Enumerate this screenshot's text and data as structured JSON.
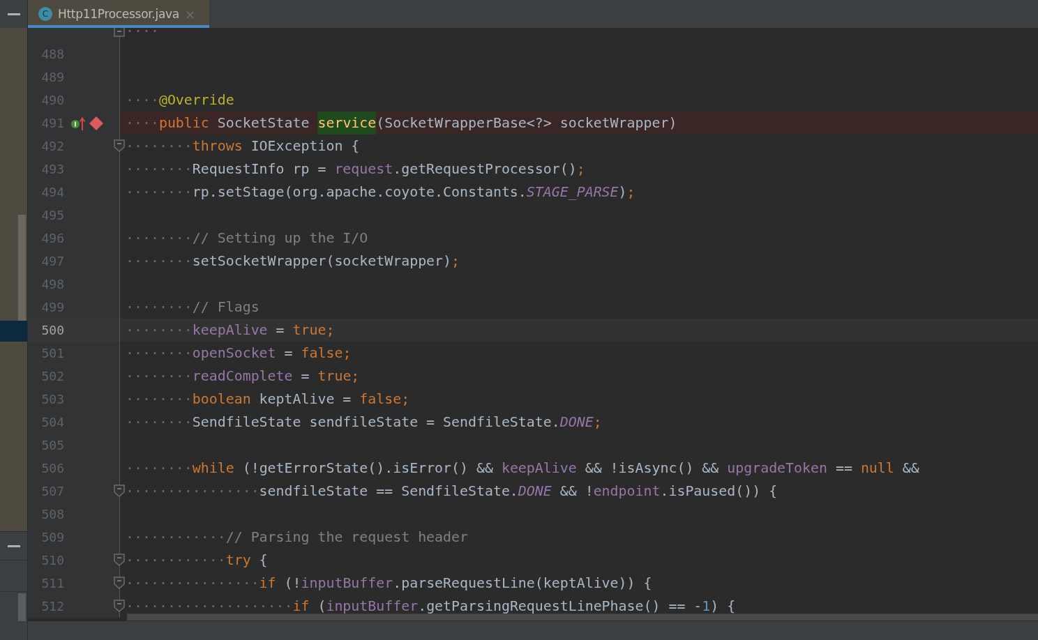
{
  "tab": {
    "icon_letter": "C",
    "label": "Http11Processor.java",
    "close": "×",
    "selected": true
  },
  "lines": [
    {
      "fold_close": true,
      "tokens": [
        {
          "kind": "ws",
          "text": "····"
        }
      ]
    },
    {
      "number": "488"
    },
    {
      "number": "489"
    },
    {
      "number": "490",
      "tokens": [
        {
          "kind": "ws",
          "text": "····"
        },
        {
          "kind": "annotation",
          "text": "@Override"
        }
      ]
    },
    {
      "number": "491",
      "breakpoint": true,
      "override_marker": true,
      "tokens": [
        {
          "kind": "ws",
          "text": "····"
        },
        {
          "kind": "keyword",
          "text": "public"
        },
        {
          "kind": "plain",
          "text": " SocketState "
        },
        {
          "kind": "declaration",
          "text": "service"
        },
        {
          "kind": "plain",
          "text": "(SocketWrapperBase<?> socketWrapper)"
        }
      ]
    },
    {
      "number": "492",
      "fold_open": true,
      "tokens": [
        {
          "kind": "ws",
          "text": "········"
        },
        {
          "kind": "keyword",
          "text": "throws"
        },
        {
          "kind": "plain",
          "text": " IOException {"
        }
      ]
    },
    {
      "number": "493",
      "tokens": [
        {
          "kind": "ws",
          "text": "········"
        },
        {
          "kind": "plain",
          "text": "RequestInfo rp = "
        },
        {
          "kind": "field",
          "text": "request"
        },
        {
          "kind": "plain",
          "text": ".getRequestProcessor()"
        },
        {
          "kind": "keyword",
          "text": ";"
        }
      ]
    },
    {
      "number": "494",
      "tokens": [
        {
          "kind": "ws",
          "text": "········"
        },
        {
          "kind": "plain",
          "text": "rp.setStage(org.apache.coyote.Constants."
        },
        {
          "kind": "constant",
          "text": "STAGE_PARSE"
        },
        {
          "kind": "plain",
          "text": ")"
        },
        {
          "kind": "keyword",
          "text": ";"
        }
      ]
    },
    {
      "number": "495"
    },
    {
      "number": "496",
      "tokens": [
        {
          "kind": "ws",
          "text": "········"
        },
        {
          "kind": "comment",
          "text": "// Setting up the I/O"
        }
      ]
    },
    {
      "number": "497",
      "tokens": [
        {
          "kind": "ws",
          "text": "········"
        },
        {
          "kind": "plain",
          "text": "setSocketWrapper(socketWrapper)"
        },
        {
          "kind": "keyword",
          "text": ";"
        }
      ]
    },
    {
      "number": "498"
    },
    {
      "number": "499",
      "tokens": [
        {
          "kind": "ws",
          "text": "········"
        },
        {
          "kind": "comment",
          "text": "// Flags"
        }
      ]
    },
    {
      "number": "500",
      "current": true,
      "tokens": [
        {
          "kind": "ws",
          "text": "········"
        },
        {
          "kind": "field",
          "text": "keepAlive"
        },
        {
          "kind": "plain",
          "text": " = "
        },
        {
          "kind": "keyword",
          "text": "true;"
        }
      ]
    },
    {
      "number": "501",
      "tokens": [
        {
          "kind": "ws",
          "text": "········"
        },
        {
          "kind": "field",
          "text": "openSocket"
        },
        {
          "kind": "plain",
          "text": " = "
        },
        {
          "kind": "keyword",
          "text": "false;"
        }
      ]
    },
    {
      "number": "502",
      "tokens": [
        {
          "kind": "ws",
          "text": "········"
        },
        {
          "kind": "field",
          "text": "readComplete"
        },
        {
          "kind": "plain",
          "text": " = "
        },
        {
          "kind": "keyword",
          "text": "true;"
        }
      ]
    },
    {
      "number": "503",
      "tokens": [
        {
          "kind": "ws",
          "text": "········"
        },
        {
          "kind": "keyword",
          "text": "boolean"
        },
        {
          "kind": "plain",
          "text": " keptAlive = "
        },
        {
          "kind": "keyword",
          "text": "false;"
        }
      ]
    },
    {
      "number": "504",
      "tokens": [
        {
          "kind": "ws",
          "text": "········"
        },
        {
          "kind": "plain",
          "text": "SendfileState sendfileState = SendfileState."
        },
        {
          "kind": "constant",
          "text": "DONE"
        },
        {
          "kind": "keyword",
          "text": ";"
        }
      ]
    },
    {
      "number": "505"
    },
    {
      "number": "506",
      "tokens": [
        {
          "kind": "ws",
          "text": "········"
        },
        {
          "kind": "keyword",
          "text": "while"
        },
        {
          "kind": "plain",
          "text": " (!getErrorState().isError() && "
        },
        {
          "kind": "field",
          "text": "keepAlive"
        },
        {
          "kind": "plain",
          "text": " && !isAsync() && "
        },
        {
          "kind": "field",
          "text": "upgradeToken"
        },
        {
          "kind": "plain",
          "text": " == "
        },
        {
          "kind": "keyword",
          "text": "null"
        },
        {
          "kind": "plain",
          "text": " &&"
        }
      ]
    },
    {
      "number": "507",
      "fold_open": true,
      "tokens": [
        {
          "kind": "ws",
          "text": "················"
        },
        {
          "kind": "plain",
          "text": "sendfileState == SendfileState."
        },
        {
          "kind": "constant",
          "text": "DONE"
        },
        {
          "kind": "plain",
          "text": " && !"
        },
        {
          "kind": "field",
          "text": "endpoint"
        },
        {
          "kind": "plain",
          "text": ".isPaused()) {"
        }
      ]
    },
    {
      "number": "508"
    },
    {
      "number": "509",
      "tokens": [
        {
          "kind": "ws",
          "text": "············"
        },
        {
          "kind": "comment",
          "text": "// Parsing the request header"
        }
      ]
    },
    {
      "number": "510",
      "fold_open": true,
      "tokens": [
        {
          "kind": "ws",
          "text": "············"
        },
        {
          "kind": "keyword",
          "text": "try"
        },
        {
          "kind": "plain",
          "text": " {"
        }
      ]
    },
    {
      "number": "511",
      "fold_open": true,
      "tokens": [
        {
          "kind": "ws",
          "text": "················"
        },
        {
          "kind": "keyword",
          "text": "if"
        },
        {
          "kind": "plain",
          "text": " (!"
        },
        {
          "kind": "field",
          "text": "inputBuffer"
        },
        {
          "kind": "plain",
          "text": ".parseRequestLine(keptAlive)) {"
        }
      ]
    },
    {
      "number": "512",
      "fold_open": true,
      "tokens": [
        {
          "kind": "ws",
          "text": "····················"
        },
        {
          "kind": "keyword",
          "text": "if"
        },
        {
          "kind": "plain",
          "text": " ("
        },
        {
          "kind": "field",
          "text": "inputBuffer"
        },
        {
          "kind": "plain",
          "text": ".getParsingRequestLinePhase() == -"
        },
        {
          "kind": "number",
          "text": "1"
        },
        {
          "kind": "plain",
          "text": ") {"
        }
      ]
    }
  ]
}
